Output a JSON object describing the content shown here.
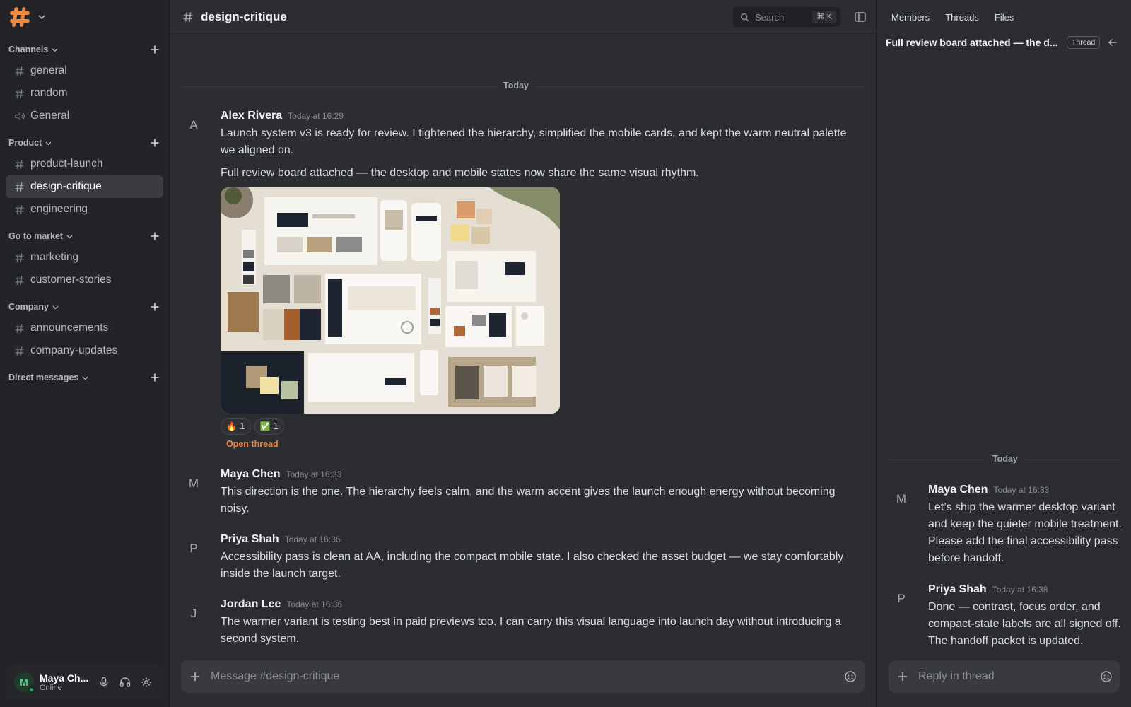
{
  "workspace": {
    "logo_icon": "hash-logo-icon",
    "accent": "#f0883e"
  },
  "sidebar": {
    "sections": [
      {
        "label": "Channels",
        "items": [
          {
            "label": "general",
            "icon": "hash-icon"
          },
          {
            "label": "random",
            "icon": "hash-icon"
          },
          {
            "label": "General",
            "icon": "speaker-icon"
          }
        ]
      },
      {
        "label": "Product",
        "items": [
          {
            "label": "product-launch",
            "icon": "hash-icon"
          },
          {
            "label": "design-critique",
            "icon": "hash-icon",
            "active": true
          },
          {
            "label": "engineering",
            "icon": "hash-icon"
          }
        ]
      },
      {
        "label": "Go to market",
        "items": [
          {
            "label": "marketing",
            "icon": "hash-icon"
          },
          {
            "label": "customer-stories",
            "icon": "hash-icon"
          }
        ]
      },
      {
        "label": "Company",
        "items": [
          {
            "label": "announcements",
            "icon": "hash-icon"
          },
          {
            "label": "company-updates",
            "icon": "hash-icon"
          }
        ]
      },
      {
        "label": "Direct messages",
        "items": []
      }
    ]
  },
  "user": {
    "initial": "M",
    "name": "Maya Ch...",
    "status": "Online"
  },
  "channel": {
    "name": "design-critique",
    "search_placeholder": "Search",
    "search_shortcut": "⌘ K",
    "day_divider": "Today",
    "composer_placeholder": "Message #design-critique"
  },
  "messages": [
    {
      "initial": "A",
      "author": "Alex Rivera",
      "time": "Today at 16:29",
      "text": "Launch system v3 is ready for review. I tightened the hierarchy, simplified the mobile cards, and kept the warm neutral palette we aligned on.",
      "text2": "Full review board attached — the desktop and mobile states now share the same visual rhythm.",
      "reactions": [
        {
          "emoji": "🔥",
          "count": "1"
        },
        {
          "emoji": "✅",
          "count": "1"
        }
      ],
      "thread_link": "Open thread"
    },
    {
      "initial": "M",
      "author": "Maya Chen",
      "time": "Today at 16:33",
      "text": "This direction is the one. The hierarchy feels calm, and the warm accent gives the launch enough energy without becoming noisy."
    },
    {
      "initial": "P",
      "author": "Priya Shah",
      "time": "Today at 16:36",
      "text": "Accessibility pass is clean at AA, including the compact mobile state. I also checked the asset budget — we stay comfortably inside the launch target."
    },
    {
      "initial": "J",
      "author": "Jordan Lee",
      "time": "Today at 16:36",
      "text": "The warmer variant is testing best in paid previews too. I can carry this visual language into launch day without introducing a second system."
    }
  ],
  "thread": {
    "tabs": [
      "Members",
      "Threads",
      "Files"
    ],
    "title": "Full review board attached — the d...",
    "badge": "Thread",
    "day_divider": "Today",
    "composer_placeholder": "Reply in thread",
    "replies": [
      {
        "initial": "M",
        "author": "Maya Chen",
        "time": "Today at 16:33",
        "text": "Let’s ship the warmer desktop variant and keep the quieter mobile treatment. Please add the final accessibility pass before handoff."
      },
      {
        "initial": "P",
        "author": "Priya Shah",
        "time": "Today at 16:38",
        "text": "Done — contrast, focus order, and compact-state labels are all signed off. The handoff packet is updated."
      }
    ]
  }
}
